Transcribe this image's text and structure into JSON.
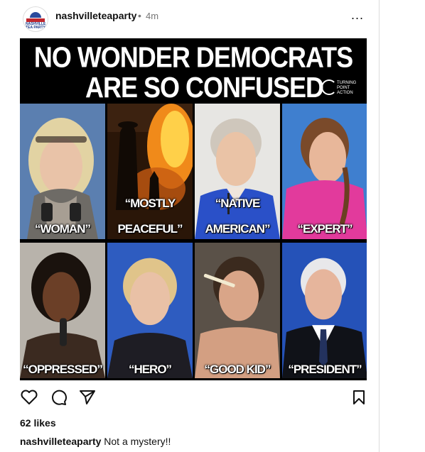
{
  "post": {
    "username": "nashvilleteaparty",
    "separator": "•",
    "time": "4m",
    "more_label": "...",
    "avatar_text": "NASHVILLE TEA PARTY"
  },
  "image": {
    "headline_line1": "NO WONDER DEMOCRATS",
    "headline_line2": "ARE SO CONFUSED",
    "logo_text": "TURNING POINT ACTION",
    "panels": [
      {
        "line1": "",
        "line2": "“WOMAN”"
      },
      {
        "line1": "“MOSTLY",
        "line2": "PEACEFUL”"
      },
      {
        "line1": "“NATIVE",
        "line2": "AMERICAN”"
      },
      {
        "line1": "",
        "line2": "“EXPERT”"
      },
      {
        "line1": "",
        "line2": "“OPPRESSED”"
      },
      {
        "line1": "",
        "line2": "“HERO”"
      },
      {
        "line1": "",
        "line2": "“GOOD KID”"
      },
      {
        "line1": "",
        "line2": "“PRESIDENT”"
      }
    ]
  },
  "footer": {
    "likes": "62 likes",
    "caption_user": "nashvilleteaparty",
    "caption_text": "Not a mystery!!"
  },
  "icons": [
    "heart-icon",
    "comment-icon",
    "share-icon",
    "bookmark-icon",
    "more-icon"
  ]
}
